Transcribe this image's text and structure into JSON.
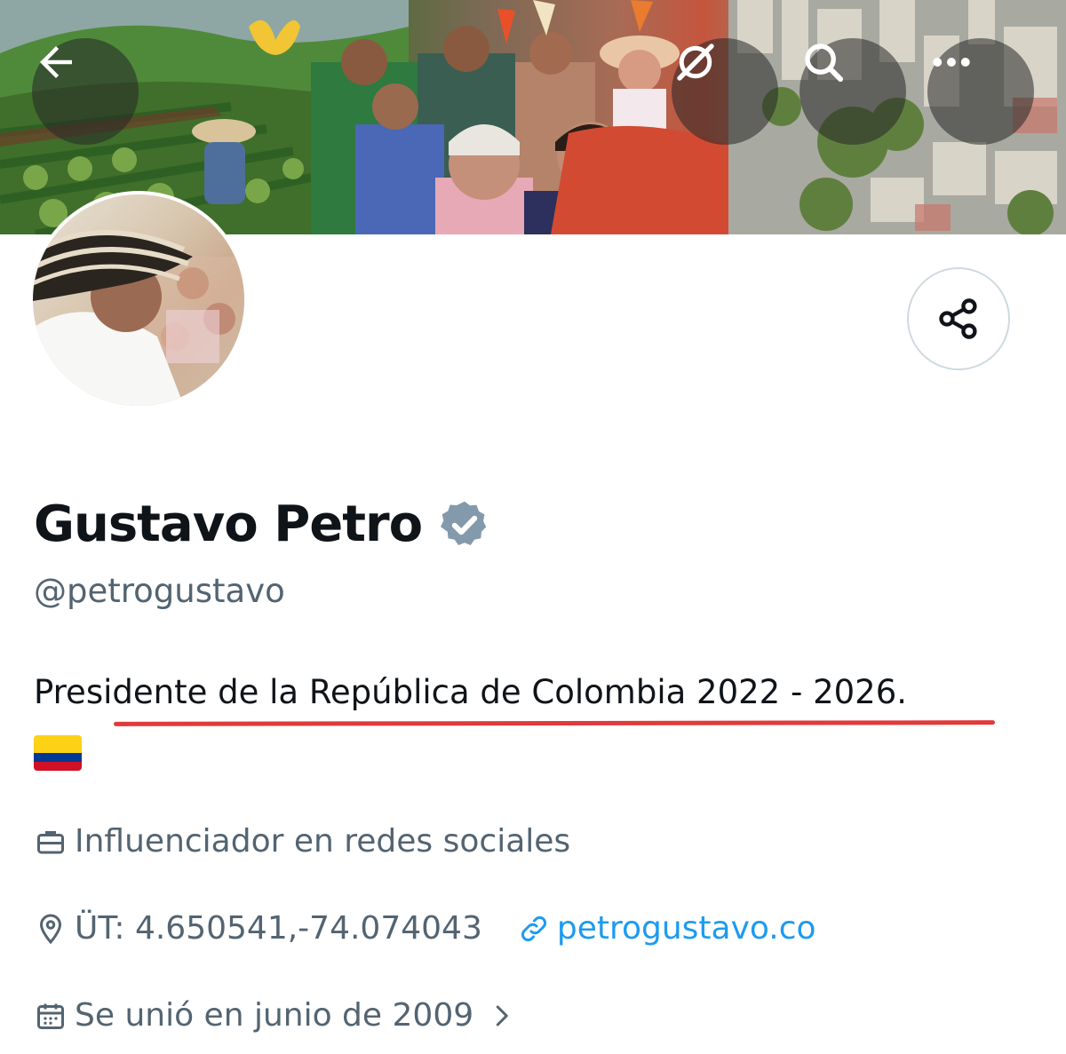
{
  "header": {
    "back_icon": "arrow-left-icon",
    "grok_icon": "grok-icon",
    "search_icon": "search-icon",
    "more_icon": "more-horizontal-icon"
  },
  "profile": {
    "name": "Gustavo Petro",
    "verified": true,
    "handle": "@petrogustavo",
    "bio": "Presidente de la República de Colombia 2022 - 2026.",
    "bio_emoji": "colombia-flag",
    "category": "Influenciador en redes sociales",
    "location": "ÜT: 4.650541,-74.074043",
    "website": "petrogustavo.co",
    "joined": "Se unió en junio de 2009"
  },
  "colors": {
    "name": "#0f1419",
    "secondary": "#536471",
    "link": "#1d9bf0",
    "verified_badge": "#829aab",
    "underline": "#e03a3a"
  }
}
